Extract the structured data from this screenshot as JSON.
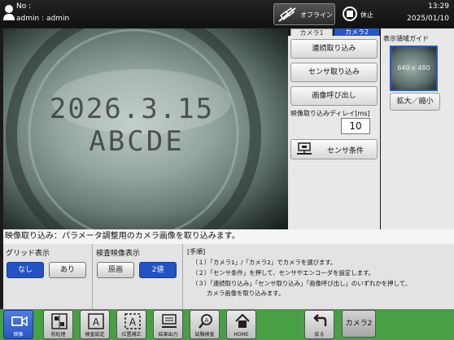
{
  "header": {
    "no_label": "No :",
    "user": "admin : admin",
    "offline_label": "オフライン",
    "stop_label": "休止",
    "time": "13:29",
    "date": "2025/01/10"
  },
  "camera_view": {
    "print_line1": "2026.3.15",
    "print_line2": "ABCDE"
  },
  "camera_tabs": {
    "tab1": "カメラ1",
    "tab2": "カメラ2"
  },
  "controls": {
    "continuous_capture": "連続取り込み",
    "sensor_capture": "センサ取り込み",
    "image_recall": "画像呼び出し",
    "delay_label": "映像取り込みディレイ[ms]",
    "delay_value": "10",
    "sensor_conditions": "センサ条件"
  },
  "guide": {
    "title": "表示領域ガイド",
    "resolution": "640 x 480",
    "zoom_button": "拡大／縮小"
  },
  "message": "映像取り込み：パラメータ調整用のカメラ画像を取り込みます。",
  "grid_display": {
    "title": "グリッド表示",
    "off": "なし",
    "on": "あり"
  },
  "check_display": {
    "title": "検査映像表示",
    "original": "原画",
    "binary": "2値"
  },
  "procedure": {
    "title": "[手順]",
    "step1": "（１）「カメラ1」/「カメラ2」でカメラを選びます。",
    "step2": "（２）「センサ条件」を押して、センサやエンコーダを設定します。",
    "step3": "（３）「連続取り込み」「センサ取り込み」「画像呼び出し」のいずれかを押して、",
    "step3b": "カメラ画像を取り込みます。"
  },
  "taskbar": {
    "video": "映像",
    "preprocess": "前処理",
    "inspection_settings": "検査設定",
    "position_correction": "位置補正",
    "result_output": "結果出力",
    "test_inspection": "試験検査",
    "home": "HOME",
    "back": "戻る",
    "camera2": "カメラ2"
  }
}
